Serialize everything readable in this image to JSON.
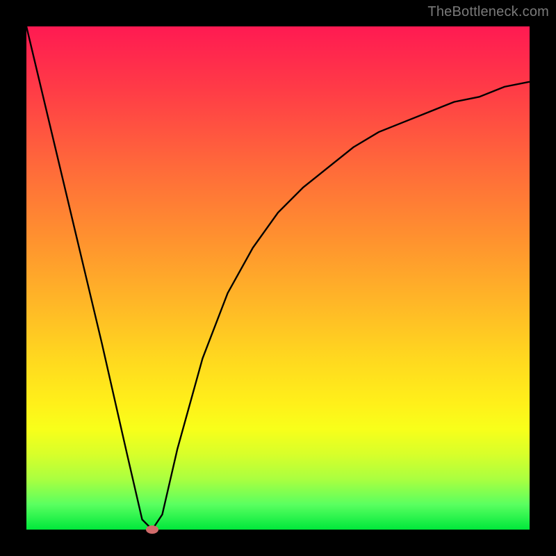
{
  "watermark": "TheBottleneck.com",
  "colors": {
    "top": "#ff1a52",
    "mid1": "#ff912f",
    "mid2": "#fff01a",
    "bottom": "#00e83b",
    "curve": "#000000",
    "marker": "#d16a6a",
    "frame": "#000000"
  },
  "chart_data": {
    "type": "line",
    "title": "",
    "xlabel": "",
    "ylabel": "",
    "xlim": [
      0,
      100
    ],
    "ylim": [
      0,
      100
    ],
    "series": [
      {
        "name": "bottleneck-curve",
        "x": [
          0,
          5,
          10,
          15,
          20,
          23,
          25,
          27,
          30,
          35,
          40,
          45,
          50,
          55,
          60,
          65,
          70,
          75,
          80,
          85,
          90,
          95,
          100
        ],
        "y": [
          100,
          79,
          58,
          37,
          15,
          2,
          0,
          3,
          16,
          34,
          47,
          56,
          63,
          68,
          72,
          76,
          79,
          81,
          83,
          85,
          86,
          88,
          89
        ]
      }
    ],
    "annotations": [
      {
        "name": "optimal-point",
        "x": 25,
        "y": 0
      }
    ],
    "grid": false,
    "legend": false
  }
}
